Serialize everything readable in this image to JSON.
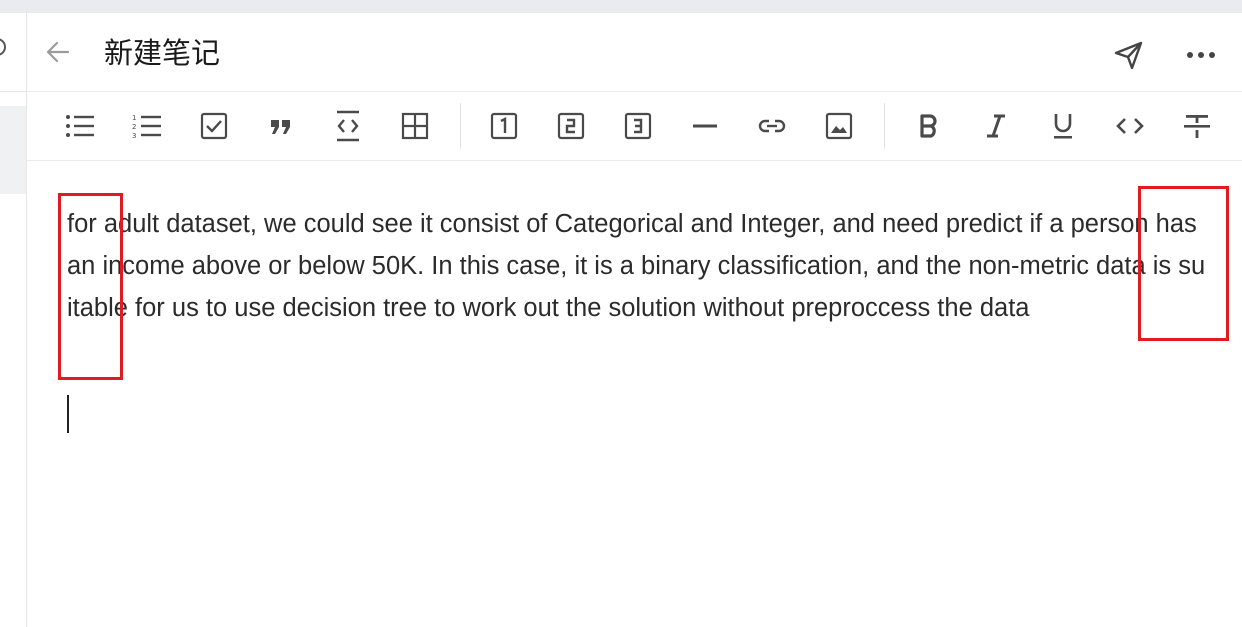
{
  "header": {
    "title": "新建笔记",
    "back_icon": "arrow-left-icon",
    "send_icon": "send-icon",
    "more_icon": "more-horizontal-icon"
  },
  "toolbar": {
    "items": [
      {
        "name": "bullet-list",
        "icon": "bullet-list-icon"
      },
      {
        "name": "numbered-list",
        "icon": "numbered-list-icon"
      },
      {
        "name": "checkbox",
        "icon": "checkbox-icon"
      },
      {
        "name": "quote",
        "icon": "quote-icon"
      },
      {
        "name": "code-block",
        "icon": "code-block-icon"
      },
      {
        "name": "table",
        "icon": "table-icon"
      },
      {
        "name": "heading-1",
        "icon": "heading-1-icon",
        "label": "1"
      },
      {
        "name": "heading-2",
        "icon": "heading-2-icon",
        "label": "2"
      },
      {
        "name": "heading-3",
        "icon": "heading-3-icon",
        "label": "3"
      },
      {
        "name": "horizontal-rule",
        "icon": "horizontal-rule-icon"
      },
      {
        "name": "link",
        "icon": "link-icon"
      },
      {
        "name": "image",
        "icon": "image-icon"
      },
      {
        "name": "bold",
        "icon": "bold-icon",
        "label": "B"
      },
      {
        "name": "italic",
        "icon": "italic-icon",
        "label": "I"
      },
      {
        "name": "underline",
        "icon": "underline-icon",
        "label": "U"
      },
      {
        "name": "inline-code",
        "icon": "inline-code-icon",
        "label": "<>"
      },
      {
        "name": "strikethrough",
        "icon": "strikethrough-icon"
      }
    ]
  },
  "editor": {
    "content": "for adult dataset,  we could see it consist of Categorical and Integer, and need predict if a person has an income above or below 50K. In this case, it is a binary classification, and the non-metric data is suitable for us to use decision tree to work out the solution without preproccess the data"
  },
  "colors": {
    "annotation": "#e11b22",
    "icon": "#4a4a4a",
    "topbar": "#e9ebee"
  }
}
